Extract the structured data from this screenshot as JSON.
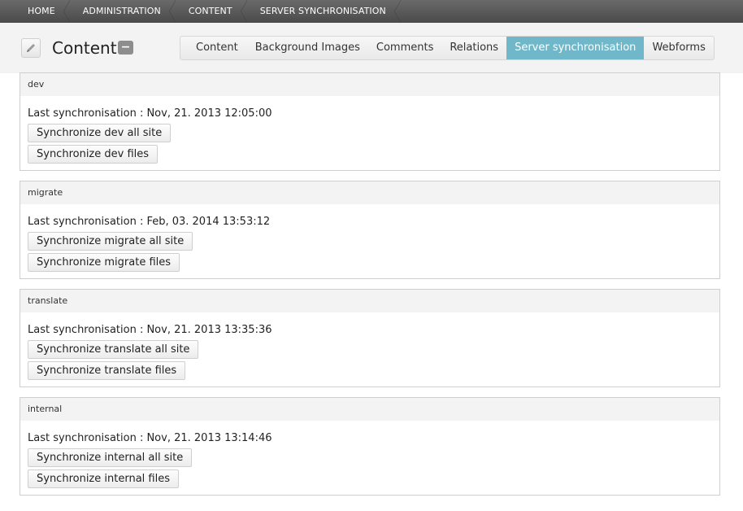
{
  "breadcrumb": [
    "HOME",
    "ADMINISTRATION",
    "CONTENT",
    "SERVER SYNCHRONISATION"
  ],
  "header": {
    "title": "Content",
    "collapse_label": "−",
    "edit_icon": "pencil-icon"
  },
  "tabs": [
    {
      "label": "Content",
      "active": false
    },
    {
      "label": "Background Images",
      "active": false
    },
    {
      "label": "Comments",
      "active": false
    },
    {
      "label": "Relations",
      "active": false
    },
    {
      "label": "Server synchronisation",
      "active": true
    },
    {
      "label": "Webforms",
      "active": false
    }
  ],
  "colors": {
    "active_tab": "#6fb7c9",
    "breadcrumb_bg": "#555555"
  },
  "servers": [
    {
      "name": "dev",
      "last_sync": "Last synchronisation : Nov, 21. 2013 12:05:00",
      "btn_all": "Synchronize dev all site",
      "btn_files": "Synchronize dev files"
    },
    {
      "name": "migrate",
      "last_sync": "Last synchronisation : Feb, 03. 2014 13:53:12",
      "btn_all": "Synchronize migrate all site",
      "btn_files": "Synchronize migrate files"
    },
    {
      "name": "translate",
      "last_sync": "Last synchronisation : Nov, 21. 2013 13:35:36",
      "btn_all": "Synchronize translate all site",
      "btn_files": "Synchronize translate files"
    },
    {
      "name": "internal",
      "last_sync": "Last synchronisation : Nov, 21. 2013 13:14:46",
      "btn_all": "Synchronize internal all site",
      "btn_files": "Synchronize internal files"
    }
  ]
}
